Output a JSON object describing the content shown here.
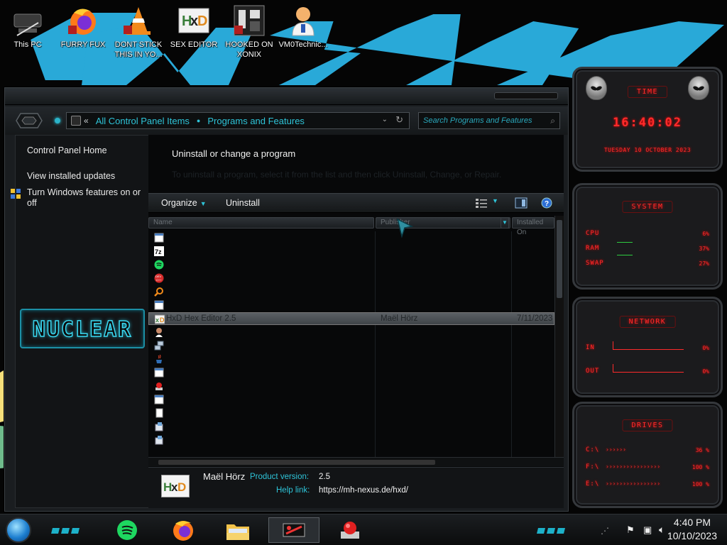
{
  "desktop": {
    "icons": [
      {
        "label": "This PC"
      },
      {
        "label": "FURRY FUX"
      },
      {
        "label": "DONT STICK THIS IN YO..."
      },
      {
        "label": "SEX EDITOR"
      },
      {
        "label": "HOOKED ON XONIX"
      },
      {
        "label": "VM0Technic..."
      }
    ]
  },
  "explorer": {
    "breadcrumb": [
      "All Control Panel Items",
      "Programs and Features"
    ],
    "search_placeholder": "Search Programs and Features",
    "left_links": [
      "Control Panel Home",
      "View installed updates",
      "Turn Windows features on or off"
    ],
    "nuclear_logo": "NUCLEAR",
    "task_title": "Uninstall or change a program",
    "task_subtitle": "To uninstall a program, select it from the list and then click Uninstall, Change, or Repair.",
    "toolbar": {
      "organize": "Organize",
      "uninstall": "Uninstall"
    },
    "columns": [
      "Name",
      "Publisher",
      "Installed On"
    ],
    "programs": [
      {
        "name": "",
        "publisher": "",
        "date": "",
        "icon": "window-icon"
      },
      {
        "name": "",
        "publisher": "",
        "date": "",
        "icon": "7zip-icon"
      },
      {
        "name": "",
        "publisher": "",
        "date": "",
        "icon": "spotify-icon"
      },
      {
        "name": "",
        "publisher": "",
        "date": "",
        "icon": "devcpp-icon"
      },
      {
        "name": "",
        "publisher": "",
        "date": "",
        "icon": "search-magnifier-icon"
      },
      {
        "name": "",
        "publisher": "",
        "date": "",
        "icon": "window-icon"
      },
      {
        "name": "HxD Hex Editor 2.5",
        "publisher": "Maël Hörz",
        "date": "7/11/2023",
        "icon": "hxd-icon",
        "selected": true
      },
      {
        "name": "",
        "publisher": "",
        "date": "",
        "icon": "person-icon"
      },
      {
        "name": "",
        "publisher": "",
        "date": "",
        "icon": "network-icon"
      },
      {
        "name": "",
        "publisher": "",
        "date": "",
        "icon": "java-icon"
      },
      {
        "name": "",
        "publisher": "",
        "date": "",
        "icon": "window-icon"
      },
      {
        "name": "",
        "publisher": "",
        "date": "",
        "icon": "red-button-icon"
      },
      {
        "name": "",
        "publisher": "",
        "date": "",
        "icon": "window-icon"
      },
      {
        "name": "",
        "publisher": "",
        "date": "",
        "icon": "document-icon"
      },
      {
        "name": "",
        "publisher": "",
        "date": "",
        "icon": "installer-icon"
      },
      {
        "name": "",
        "publisher": "",
        "date": "",
        "icon": "installer-icon"
      }
    ],
    "details": {
      "publisher": "Maël Hörz",
      "version_key": "Product version:",
      "version_value": "2.5",
      "help_key": "Help link:",
      "help_value": "https://mh-nexus.de/hxd/"
    }
  },
  "gadgets": {
    "time": {
      "title": "TIME",
      "clock": "16:40:02",
      "date": "TUESDAY 10 OCTOBER 2023"
    },
    "system": {
      "title": "SYSTEM",
      "rows": [
        {
          "label": "CPU",
          "value": "6%"
        },
        {
          "label": "RAM",
          "value": "37%"
        },
        {
          "label": "SWAP",
          "value": "27%"
        }
      ]
    },
    "network": {
      "title": "NETWORK",
      "rows": [
        {
          "label": "IN",
          "value": "0%"
        },
        {
          "label": "OUT",
          "value": "0%"
        }
      ]
    },
    "drives": {
      "title": "DRIVES",
      "rows": [
        {
          "label": "C:\\",
          "value": "36 %"
        },
        {
          "label": "F:\\",
          "value": "100 %"
        },
        {
          "label": "E:\\",
          "value": "100 %"
        }
      ]
    }
  },
  "taskbar": {
    "time": "4:40 PM",
    "date": "10/10/2023",
    "apps": [
      "spotify-icon",
      "firefox-icon",
      "file-explorer-icon",
      "control-panel-icon",
      "red-button-icon"
    ]
  },
  "colors": {
    "accent_cyan": "#2ec4d8",
    "gadget_red": "#ff2b2b",
    "wallpaper_blue": "#29a9d8"
  }
}
